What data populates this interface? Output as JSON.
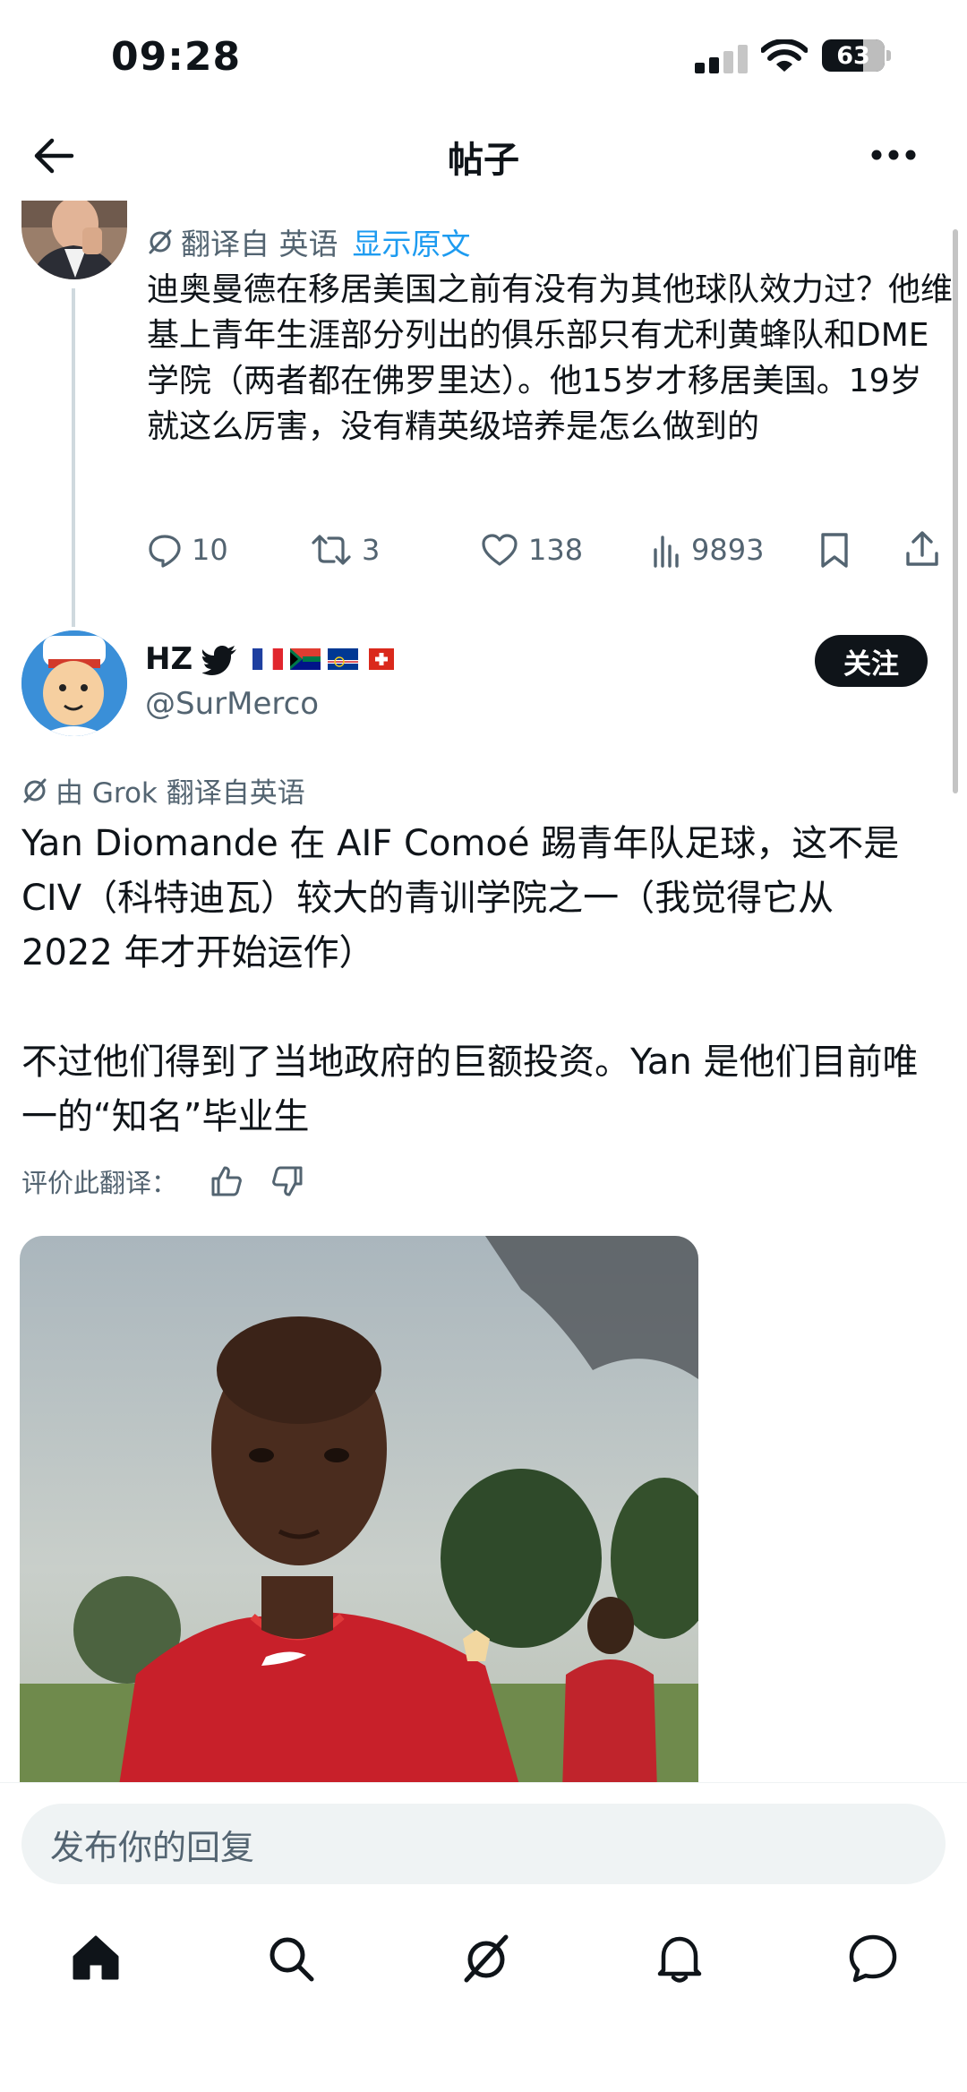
{
  "status_bar": {
    "time": "09:28",
    "battery": "63"
  },
  "header": {
    "title": "帖子"
  },
  "reply_tweet": {
    "translated_from": "翻译自 英语",
    "show_original": "显示原文",
    "text": "迪奥曼德在移居美国之前有没有为其他球队效力过？他维基上青年生涯部分列出的俱乐部只有尤利黄蜂队和DME学院（两者都在佛罗里达）。他15岁才移居美国。19岁就这么厉害，没有精英级培养是怎么做到的",
    "replies": "10",
    "reposts": "3",
    "likes": "138",
    "views": "9893"
  },
  "main_tweet": {
    "author_name": "HZ",
    "author_handle": "@SurMerco",
    "follow_label": "关注",
    "grok_translation": "由 Grok 翻译自英语",
    "paragraph_1": "Yan Diomande 在 AIF Comoé 踢青年队足球，这不是 CIV（科特迪瓦）较大的青训学院之一（我觉得它从 2022 年才开始运作）",
    "paragraph_2": "不过他们得到了当地政府的巨额投资。Yan 是他们目前唯一的“知名”毕业生",
    "rate_label": "评价此翻译："
  },
  "reply_composer": {
    "placeholder": "发布你的回复"
  },
  "tabs": [
    "home-icon",
    "search-icon",
    "grok-icon",
    "notifications-icon",
    "messages-icon"
  ],
  "colors": {
    "accent": "#1d9bf0",
    "text": "#0f1419",
    "secondary": "#536471",
    "jersey": "#c8202a"
  }
}
